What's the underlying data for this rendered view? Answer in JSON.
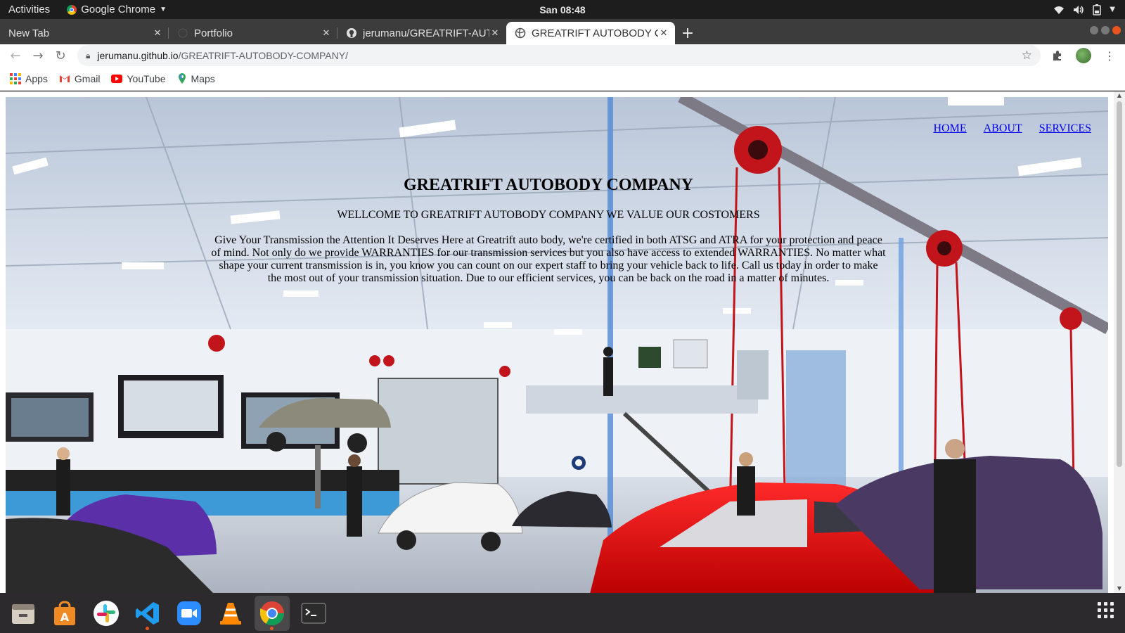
{
  "system": {
    "activities": "Activities",
    "app_name": "Google Chrome",
    "clock": "San 08:48"
  },
  "browser": {
    "tabs": [
      {
        "title": "New Tab",
        "active": false
      },
      {
        "title": "Portfolio",
        "active": false
      },
      {
        "title": "jerumanu/GREATRIFT-AUTOBODY-COMPANY",
        "active": false
      },
      {
        "title": "GREATRIFT AUTOBODY COMPANY",
        "active": true
      }
    ],
    "url_host": "jerumanu.github.io",
    "url_path": "/GREATRIFT-AUTOBODY-COMPANY/",
    "bookmarks": [
      {
        "label": "Apps",
        "icon": "apps-grid-icon"
      },
      {
        "label": "Gmail",
        "icon": "gmail-icon"
      },
      {
        "label": "YouTube",
        "icon": "youtube-icon"
      },
      {
        "label": "Maps",
        "icon": "maps-icon"
      }
    ]
  },
  "site": {
    "nav": [
      "HOME",
      "ABOUT",
      "SERVICES"
    ],
    "title": "GREATRIFT AUTOBODY COMPANY",
    "welcome": "WELLCOME TO GREATRIFT AUTOBODY COMPANY WE VALUE OUR COSTOMERS",
    "paragraph": "Give Your Transmission the Attention It Deserves Here at Greatrift auto body, we're certified in both ATSG and ATRA for your protection and peace of mind. Not only do we provide WARRANTIES for our transmission services but you also have access to extended WARRANTIES. No matter what shape your current transmission is in, you know you can count on our expert staff to bring your vehicle back to life. Call us today in order to make the most out of your transmission situation. Due to our efficient services, you can be back on the road in a matter of minutes.",
    "link_color": "#0000ee"
  },
  "dock": {
    "apps": [
      "files-icon",
      "software-center-icon",
      "slack-icon",
      "vscode-icon",
      "zoom-icon",
      "vlc-icon",
      "chrome-icon",
      "terminal-icon"
    ],
    "active_app": "chrome-icon"
  },
  "colors": {
    "ubuntu_orange": "#e95420",
    "topbar": "#1d1d1d",
    "tabstrip": "#3c3c3c"
  }
}
